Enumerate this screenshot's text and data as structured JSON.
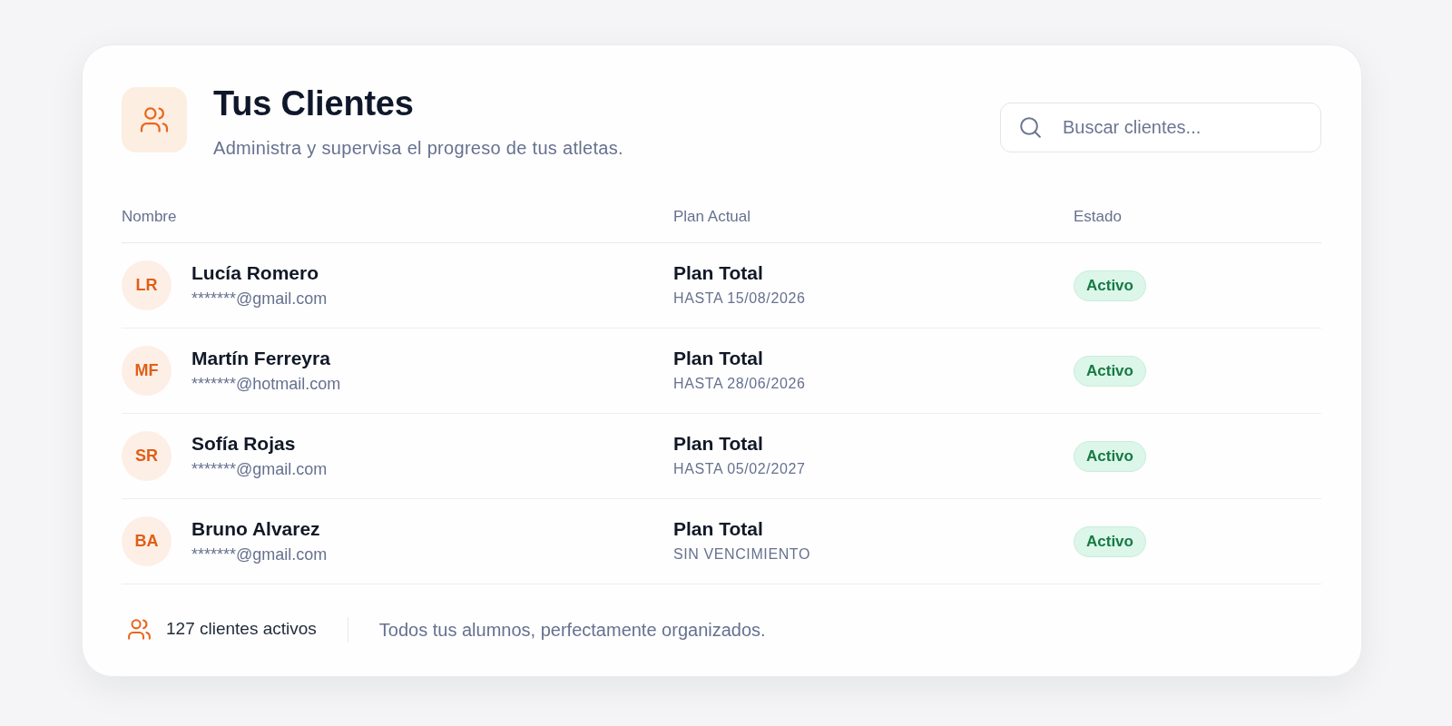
{
  "header": {
    "title": "Tus Clientes",
    "subtitle": "Administra y supervisa el progreso de tus atletas."
  },
  "search": {
    "placeholder": "Buscar clientes..."
  },
  "table": {
    "columns": [
      "Nombre",
      "Plan Actual",
      "Estado"
    ],
    "rows": [
      {
        "initials": "LR",
        "name": "Lucía Romero",
        "email": "*******@gmail.com",
        "plan": "Plan Total",
        "plan_detail": "HASTA 15/08/2026",
        "status": "Activo"
      },
      {
        "initials": "MF",
        "name": "Martín Ferreyra",
        "email": "*******@hotmail.com",
        "plan": "Plan Total",
        "plan_detail": "HASTA 28/06/2026",
        "status": "Activo"
      },
      {
        "initials": "SR",
        "name": "Sofía Rojas",
        "email": "*******@gmail.com",
        "plan": "Plan Total",
        "plan_detail": "HASTA 05/02/2027",
        "status": "Activo"
      },
      {
        "initials": "BA",
        "name": "Bruno Alvarez",
        "email": "*******@gmail.com",
        "plan": "Plan Total",
        "plan_detail": "SIN VENCIMIENTO",
        "status": "Activo"
      }
    ]
  },
  "footer": {
    "count": "127 clientes activos",
    "note": "Todos tus alumnos, perfectamente organizados."
  }
}
